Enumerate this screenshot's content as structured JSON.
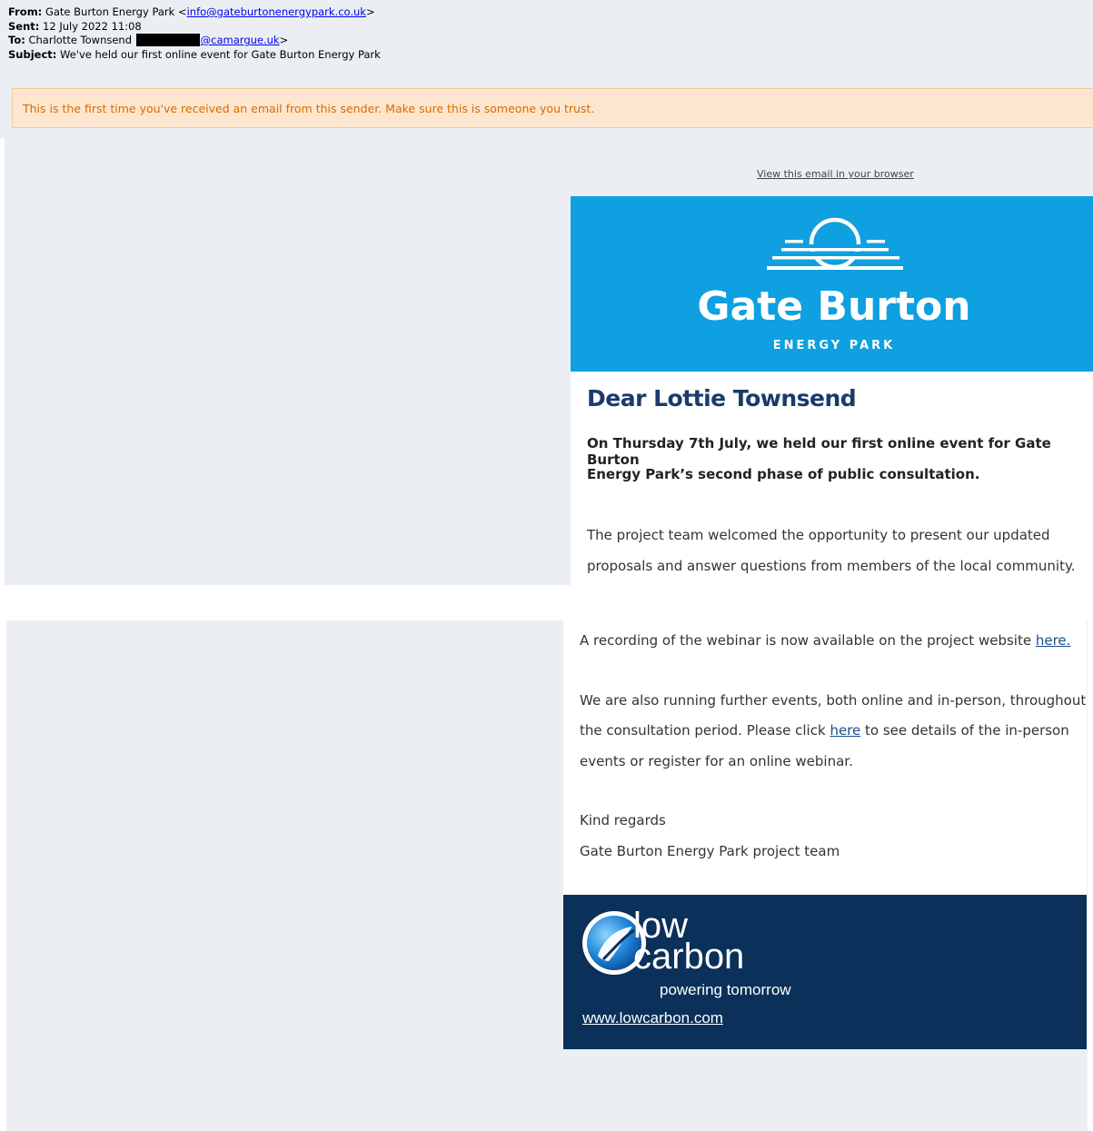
{
  "header": {
    "from_label": "From:",
    "from_name": "Gate Burton Energy Park <",
    "from_email": "info@gateburtonenergypark.co.uk",
    "from_close": ">",
    "sent_label": "Sent:",
    "sent_value": "12 July 2022 11:08",
    "to_label": "To:",
    "to_name": "Charlotte Townsend ",
    "to_email_domain": "@camargue.uk",
    "to_close": ">",
    "subject_label": "Subject:",
    "subject_value": "We've held our first online event for Gate Burton Energy Park"
  },
  "warning": "This is the first time you've received an email from this sender. Make sure this is someone you trust.",
  "view_in_browser": "View this email in your browser",
  "logo": {
    "name": "Gate Burton",
    "tagline": "ENERGY PARK"
  },
  "body": {
    "greeting": "Dear Lottie Townsend",
    "intro_line1": "On Thursday 7th July, we held our first online event for Gate Burton",
    "intro_line2": "Energy Park’s second phase of public consultation.",
    "p1_line1": "The project team welcomed the opportunity to present our updated",
    "p1_line2": "proposals and answer questions from members of the local community.",
    "p2_text": "A recording of the webinar is now available on the project website ",
    "p2_link": "here.",
    "p3_line1": "We are also running further events, both online and in-person, throughout",
    "p3_line2_pre": "the consultation period. Please click ",
    "p3_link": "here",
    "p3_line2_post": " to see details of the in-person",
    "p3_line3": "events or register for an online webinar.",
    "signoff": "Kind regards",
    "signature": "Gate Burton Energy Park project team"
  },
  "footer": {
    "brand_line1": "low",
    "brand_line2": "carbon",
    "tagline": "powering tomorrow",
    "url": "www.lowcarbon.com"
  },
  "colors": {
    "banner": "#0ea0e0",
    "footer": "#0b3059",
    "heading": "#1b3b6a",
    "warning_bg": "#fde6cf",
    "warning_text": "#d96b00",
    "page_bg": "#ebeff4"
  }
}
